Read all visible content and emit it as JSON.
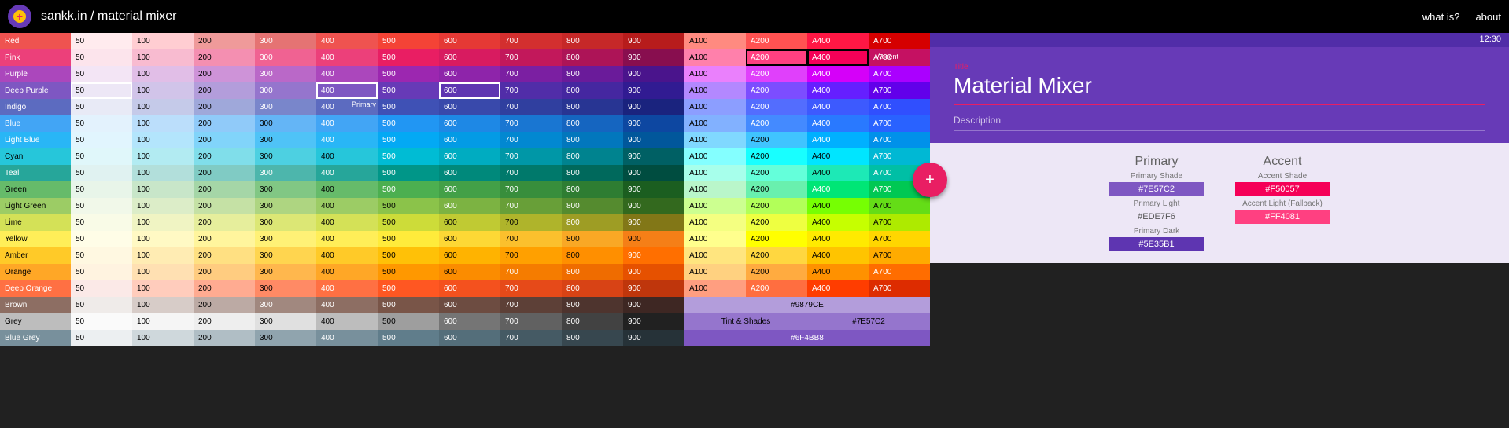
{
  "header": {
    "title": "sankk.in / material mixer",
    "links": [
      "what is?",
      "about"
    ]
  },
  "shades": [
    "50",
    "100",
    "200",
    "300",
    "400",
    "500",
    "600",
    "700",
    "800",
    "900"
  ],
  "accents": [
    "A100",
    "A200",
    "A400",
    "A700"
  ],
  "rows": [
    {
      "name": "Red",
      "c": [
        "#FFEBEE",
        "#FFCDD2",
        "#EF9A9A",
        "#E57373",
        "#EF5350",
        "#F44336",
        "#E53935",
        "#D32F2F",
        "#C62828",
        "#B71C1C",
        "#FF8A80",
        "#FF5252",
        "#FF1744",
        "#D50000"
      ]
    },
    {
      "name": "Pink",
      "c": [
        "#FCE4EC",
        "#F8BBD0",
        "#F48FB1",
        "#F06292",
        "#EC407A",
        "#E91E63",
        "#D81B60",
        "#C2185B",
        "#AD1457",
        "#880E4F",
        "#FF80AB",
        "#FF4081",
        "#F50057",
        "#C51162"
      ]
    },
    {
      "name": "Purple",
      "c": [
        "#F3E5F5",
        "#E1BEE7",
        "#CE93D8",
        "#BA68C8",
        "#AB47BC",
        "#9C27B0",
        "#8E24AA",
        "#7B1FA2",
        "#6A1B9A",
        "#4A148C",
        "#EA80FC",
        "#E040FB",
        "#D500F9",
        "#AA00FF"
      ]
    },
    {
      "name": "Deep Purple",
      "c": [
        "#EDE7F6",
        "#D1C4E9",
        "#B39DDB",
        "#9575CD",
        "#7E57C2",
        "#673AB7",
        "#5E35B1",
        "#512DA8",
        "#4527A0",
        "#311B92",
        "#B388FF",
        "#7C4DFF",
        "#651FFF",
        "#6200EA"
      ]
    },
    {
      "name": "Indigo",
      "c": [
        "#E8EAF6",
        "#C5CAE9",
        "#9FA8DA",
        "#7986CB",
        "#5C6BC0",
        "#3F51B5",
        "#3949AB",
        "#303F9F",
        "#283593",
        "#1A237E",
        "#8C9EFF",
        "#536DFE",
        "#3D5AFE",
        "#304FFE"
      ]
    },
    {
      "name": "Blue",
      "c": [
        "#E3F2FD",
        "#BBDEFB",
        "#90CAF9",
        "#64B5F6",
        "#42A5F5",
        "#2196F3",
        "#1E88E5",
        "#1976D2",
        "#1565C0",
        "#0D47A1",
        "#82B1FF",
        "#448AFF",
        "#2979FF",
        "#2962FF"
      ]
    },
    {
      "name": "Light Blue",
      "c": [
        "#E1F5FE",
        "#B3E5FC",
        "#81D4FA",
        "#4FC3F7",
        "#29B6F6",
        "#03A9F4",
        "#039BE5",
        "#0288D1",
        "#0277BD",
        "#01579B",
        "#80D8FF",
        "#40C4FF",
        "#00B0FF",
        "#0091EA"
      ]
    },
    {
      "name": "Cyan",
      "c": [
        "#E0F7FA",
        "#B2EBF2",
        "#80DEEA",
        "#4DD0E1",
        "#26C6DA",
        "#00BCD4",
        "#00ACC1",
        "#0097A7",
        "#00838F",
        "#006064",
        "#84FFFF",
        "#18FFFF",
        "#00E5FF",
        "#00B8D4"
      ]
    },
    {
      "name": "Teal",
      "c": [
        "#E0F2F1",
        "#B2DFDB",
        "#80CBC4",
        "#4DB6AC",
        "#26A69A",
        "#009688",
        "#00897B",
        "#00796B",
        "#00695C",
        "#004D40",
        "#A7FFEB",
        "#64FFDA",
        "#1DE9B6",
        "#00BFA5"
      ]
    },
    {
      "name": "Green",
      "c": [
        "#E8F5E9",
        "#C8E6C9",
        "#A5D6A7",
        "#81C784",
        "#66BB6A",
        "#4CAF50",
        "#43A047",
        "#388E3C",
        "#2E7D32",
        "#1B5E20",
        "#B9F6CA",
        "#69F0AE",
        "#00E676",
        "#00C853"
      ]
    },
    {
      "name": "Light Green",
      "c": [
        "#F1F8E9",
        "#DCEDC8",
        "#C5E1A5",
        "#AED581",
        "#9CCC65",
        "#8BC34A",
        "#7CB342",
        "#689F38",
        "#558B2F",
        "#33691E",
        "#CCFF90",
        "#B2FF59",
        "#76FF03",
        "#64DD17"
      ]
    },
    {
      "name": "Lime",
      "c": [
        "#F9FBE7",
        "#F0F4C3",
        "#E6EE9C",
        "#DCE775",
        "#D4E157",
        "#CDDC39",
        "#C0CA33",
        "#AFB42B",
        "#9E9D24",
        "#827717",
        "#F4FF81",
        "#EEFF41",
        "#C6FF00",
        "#AEEA00"
      ]
    },
    {
      "name": "Yellow",
      "c": [
        "#FFFDE7",
        "#FFF9C4",
        "#FFF59D",
        "#FFF176",
        "#FFEE58",
        "#FFEB3B",
        "#FDD835",
        "#FBC02D",
        "#F9A825",
        "#F57F17",
        "#FFFF8D",
        "#FFFF00",
        "#FFEA00",
        "#FFD600"
      ]
    },
    {
      "name": "Amber",
      "c": [
        "#FFF8E1",
        "#FFECB3",
        "#FFE082",
        "#FFD54F",
        "#FFCA28",
        "#FFC107",
        "#FFB300",
        "#FFA000",
        "#FF8F00",
        "#FF6F00",
        "#FFE57F",
        "#FFD740",
        "#FFC400",
        "#FFAB00"
      ]
    },
    {
      "name": "Orange",
      "c": [
        "#FFF3E0",
        "#FFE0B2",
        "#FFCC80",
        "#FFB74D",
        "#FFA726",
        "#FF9800",
        "#FB8C00",
        "#F57C00",
        "#EF6C00",
        "#E65100",
        "#FFD180",
        "#FFAB40",
        "#FF9100",
        "#FF6D00"
      ]
    },
    {
      "name": "Deep Orange",
      "c": [
        "#FBE9E7",
        "#FFCCBC",
        "#FFAB91",
        "#FF8A65",
        "#FF7043",
        "#FF5722",
        "#F4511E",
        "#E64A19",
        "#D84315",
        "#BF360C",
        "#FF9E80",
        "#FF6E40",
        "#FF3D00",
        "#DD2C00"
      ]
    },
    {
      "name": "Brown",
      "c": [
        "#EFEBE9",
        "#D7CCC8",
        "#BCAAA4",
        "#A1887F",
        "#8D6E63",
        "#795548",
        "#6D4C41",
        "#5D4037",
        "#4E342E",
        "#3E2723"
      ]
    },
    {
      "name": "Grey",
      "c": [
        "#FAFAFA",
        "#F5F5F5",
        "#EEEEEE",
        "#E0E0E0",
        "#BDBDBD",
        "#9E9E9E",
        "#757575",
        "#616161",
        "#424242",
        "#212121"
      ]
    },
    {
      "name": "Blue Grey",
      "c": [
        "#ECEFF1",
        "#CFD8DC",
        "#B0BEC5",
        "#90A4AE",
        "#78909C",
        "#607D8B",
        "#546E7A",
        "#455A64",
        "#37474F",
        "#263238"
      ]
    }
  ],
  "selected": {
    "primary50": {
      "row": 3,
      "col": 0
    },
    "primary400": {
      "row": 3,
      "col": 4,
      "tag": "Primary"
    },
    "primary600": {
      "row": 3,
      "col": 6
    },
    "accentA200": {
      "row": 1,
      "col": 11
    },
    "accentA400": {
      "row": 1,
      "col": 12,
      "tag": "Accent"
    }
  },
  "tints": {
    "label": "Tint & Shades",
    "values": [
      "#9879CE",
      "#7E57C2",
      "#6F4BB8"
    ]
  },
  "panel": {
    "time": "12:30",
    "title_label": "Title",
    "title": "Material Mixer",
    "desc": "Description",
    "primary": {
      "h": "Primary",
      "shade_label": "Primary Shade",
      "shade": "#7E57C2",
      "light_label": "Primary Light",
      "light": "#EDE7F6",
      "dark_label": "Primary Dark",
      "dark": "#5E35B1"
    },
    "accent": {
      "h": "Accent",
      "shade_label": "Accent Shade",
      "shade": "#F50057",
      "light_label": "Accent Light (Fallback)",
      "light": "#FF4081"
    },
    "fab": "+"
  }
}
